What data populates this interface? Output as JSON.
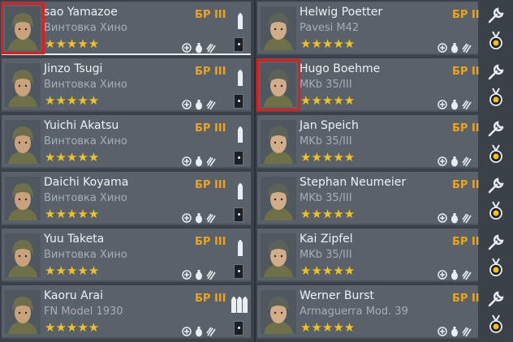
{
  "left_squad": [
    {
      "name": "sao Yamazoe",
      "weapon": "Винтовка Хино",
      "rank": "БР III",
      "stars": "★★★★★",
      "weapon_icon": "rifle-round-icon"
    },
    {
      "name": "Jinzo Tsugi",
      "weapon": "Винтовка Хино",
      "rank": "БР III",
      "stars": "★★★★★",
      "weapon_icon": "rifle-round-icon"
    },
    {
      "name": "Yuichi Akatsu",
      "weapon": "Винтовка Хино",
      "rank": "БР III",
      "stars": "★★★★★",
      "weapon_icon": "rifle-round-icon"
    },
    {
      "name": "Daichi Koyama",
      "weapon": "Винтовка Хино",
      "rank": "БР III",
      "stars": "★★★★★",
      "weapon_icon": "rifle-round-icon"
    },
    {
      "name": "Yuu Taketa",
      "weapon": "Винтовка Хино",
      "rank": "БР III",
      "stars": "★★★★★",
      "weapon_icon": "rifle-round-icon"
    },
    {
      "name": "Kaoru Arai",
      "weapon": "FN Model 1930",
      "rank": "БР III",
      "stars": "★★★★★",
      "weapon_icon": "multi-round-icon"
    }
  ],
  "right_squad": [
    {
      "name": "Helwig Poetter",
      "weapon": "Pavesi M42",
      "rank": "БР II",
      "stars": "★★★★★"
    },
    {
      "name": "Hugo Boehme",
      "weapon": "MKb 35/III",
      "rank": "БР II",
      "stars": "★★★★★"
    },
    {
      "name": "Jan Speich",
      "weapon": "MKb 35/III",
      "rank": "БР II",
      "stars": "★★★★★"
    },
    {
      "name": "Stephan Neumeier",
      "weapon": "MKb 35/III",
      "rank": "БР II",
      "stars": "★★★★★"
    },
    {
      "name": "Kai Zipfel",
      "weapon": "MKb 35/III",
      "rank": "БР II",
      "stars": "★★★★★"
    },
    {
      "name": "Werner Burst",
      "weapon": "Armaguerra Mod. 39",
      "rank": "БР II",
      "stars": "★★★★★"
    }
  ],
  "colors": {
    "background": "#3a4148",
    "card": "#59626b",
    "rank": "#f0a21a",
    "stars": "#f3c21a",
    "highlight": "#e21b1b"
  },
  "icons": [
    "medkit-icon",
    "grenade-icon",
    "ammo-icon",
    "wrench-icon",
    "medal-icon"
  ]
}
